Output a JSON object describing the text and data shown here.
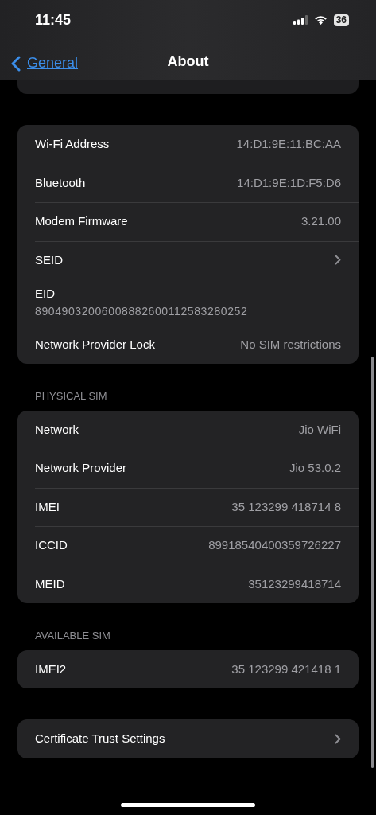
{
  "status_bar": {
    "time": "11:45",
    "battery": "36"
  },
  "nav": {
    "back": "General",
    "title": "About"
  },
  "sections": [
    {
      "rows": [
        {
          "kind": "value",
          "label": "Wi-Fi Address",
          "value": "14:D1:9E:11:BC:AA",
          "separator": false
        },
        {
          "kind": "value",
          "label": "Bluetooth",
          "value": "14:D1:9E:1D:F5:D6",
          "separator": false
        },
        {
          "kind": "value",
          "label": "Modem Firmware",
          "value": "3.21.00",
          "separator": true
        },
        {
          "kind": "link",
          "label": "SEID",
          "separator": true
        },
        {
          "kind": "stacked",
          "label": "EID",
          "value": "89049032006008882600112583280252",
          "separator": false
        },
        {
          "kind": "value",
          "label": "Network Provider Lock",
          "value": "No SIM restrictions",
          "separator": true
        }
      ]
    },
    {
      "header": "PHYSICAL SIM",
      "rows": [
        {
          "kind": "value",
          "label": "Network",
          "value": "Jio WiFi",
          "separator": false
        },
        {
          "kind": "value",
          "label": "Network Provider",
          "value": "Jio 53.0.2",
          "separator": false
        },
        {
          "kind": "value",
          "label": "IMEI",
          "value": "35 123299 418714 8",
          "separator": true
        },
        {
          "kind": "value",
          "label": "ICCID",
          "value": "89918540400359726227",
          "separator": true
        },
        {
          "kind": "value",
          "label": "MEID",
          "value": "35123299418714",
          "separator": false
        }
      ]
    },
    {
      "header": "AVAILABLE SIM",
      "rows": [
        {
          "kind": "value",
          "label": "IMEI2",
          "value": "35 123299 421418 1",
          "separator": false
        }
      ]
    },
    {
      "rows": [
        {
          "kind": "link",
          "label": "Certificate Trust Settings",
          "separator": false
        }
      ]
    }
  ]
}
